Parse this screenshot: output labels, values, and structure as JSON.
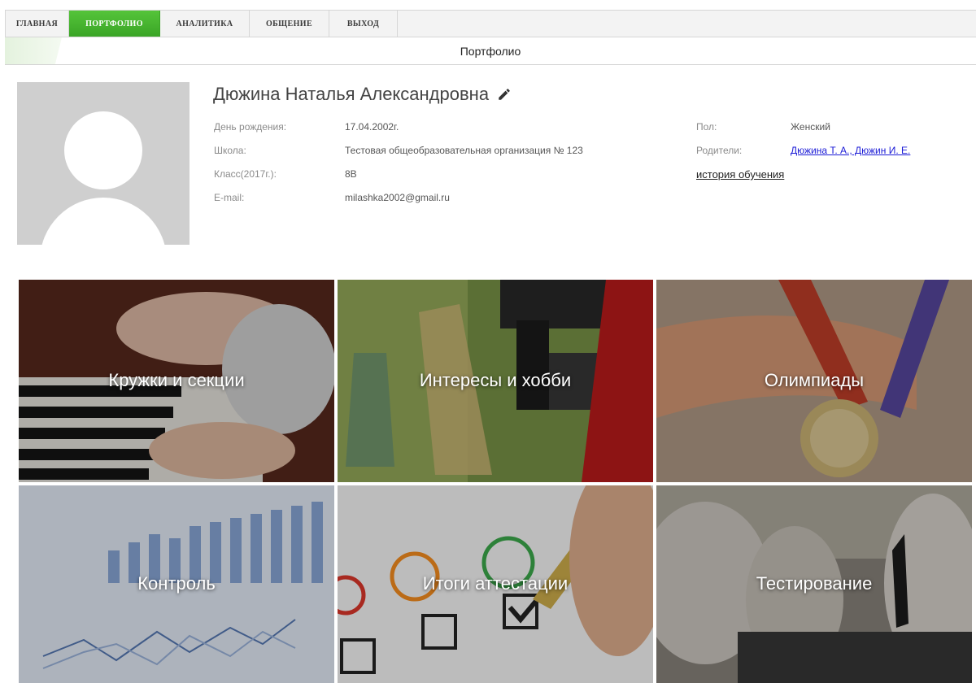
{
  "nav": {
    "tabs": [
      {
        "label": "ГЛАВНАЯ",
        "active": false
      },
      {
        "label": "ПОРТФОЛИО",
        "active": true
      },
      {
        "label": "АНАЛИТИКА",
        "active": false
      },
      {
        "label": "ОБЩЕНИЕ",
        "active": false
      },
      {
        "label": "ВЫХОД",
        "active": false
      }
    ]
  },
  "page": {
    "title": "Портфолио"
  },
  "profile": {
    "name": "Дюжина Наталья Александровна",
    "edit_icon": "pencil-icon",
    "birthday_label": "День рождения:",
    "birthday": "17.04.2002г.",
    "school_label": "Школа:",
    "school": "Тестовая общеобразовательная организация  № 123",
    "class_label": "Класс(2017г.):",
    "class": "8В",
    "email_label": "E-mail:",
    "email": "milashka2002@gmail.ru",
    "gender_label": "Пол:",
    "gender": "Женский",
    "parents_label": "Родители:",
    "parents": "Дюжина Т. А., Дюжин И. Е.",
    "history_link": "история обучения"
  },
  "tiles": [
    {
      "label": "Кружки и секции",
      "image": "piano-hands"
    },
    {
      "label": "Интересы и хобби",
      "image": "lab-microscope"
    },
    {
      "label": "Олимпиады",
      "image": "medal-ribbon"
    },
    {
      "label": "Контроль",
      "image": "charts-report"
    },
    {
      "label": "Итоги аттестации",
      "image": "smiley-checkboxes"
    },
    {
      "label": "Тестирование",
      "image": "students-writing"
    }
  ],
  "colors": {
    "accent": "#45b52f",
    "link": "#1a1ad6"
  }
}
